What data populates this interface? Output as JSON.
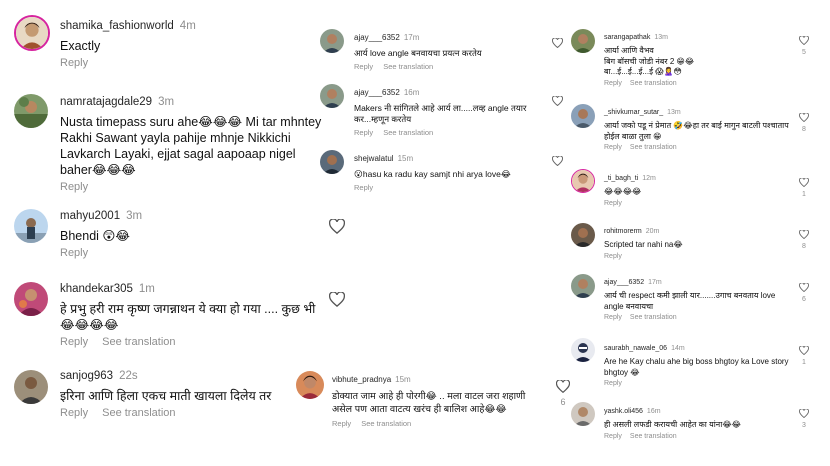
{
  "left": {
    "comments": [
      {
        "user": "shamika_fashionworld",
        "time": "4m",
        "text": "Exactly",
        "reply": "Reply"
      },
      {
        "user": "namratajagdale29",
        "time": "3m",
        "text": "Nusta timepass suru ahe😂😂😂 Mi tar mhntey Rakhi Sawant yayla pahije mhnje Nikkichi Lavkarch Layaki, ejjat sagal aapoaap nigel baher😂😂😂",
        "reply": "Reply"
      },
      {
        "user": "mahyu2001",
        "time": "3m",
        "text": "Bhendi 😲😂",
        "reply": "Reply"
      },
      {
        "user": "khandekar305",
        "time": "1m",
        "text": "हे प्रभु हरी राम कृष्ण जगन्नाथन ये क्या हो गया .... कुछ भी 😂😂😂😂",
        "reply": "Reply",
        "translate": "See translation"
      },
      {
        "user": "sanjog963",
        "time": "22s",
        "text": "इरिना आणि हिला एकच माती खायला दिलेय तर",
        "reply": "Reply",
        "translate": "See translation"
      }
    ]
  },
  "mid": {
    "comments": [
      {
        "user": "ajay___6352",
        "time": "17m",
        "text": "आर्य love angle बनवायचा प्रयत्न करतेय",
        "reply": "Reply",
        "translate": "See translation"
      },
      {
        "user": "ajay___6352",
        "time": "16m",
        "text": "Makers नी सांगितले आहे आर्य ला.....लव्ह angle तयार कर...म्हणून करतेय",
        "reply": "Reply",
        "translate": "See translation"
      },
      {
        "user": "shejwalatul",
        "time": "15m",
        "text": "😮hasu ka radu kay samjt nhi arya love😂",
        "reply": "Reply"
      },
      {
        "user": "vibhute_pradnya",
        "time": "15m",
        "text": "डोक्यात जाम आहे ही पोरगी😂 .. मला वाटल जरा शहाणी असेल पण आता वाटत्य खरंच ही बालिश आहे😂😂",
        "reply": "Reply",
        "translate": "See translation",
        "likes": "6"
      }
    ]
  },
  "right": {
    "comments": [
      {
        "user": "sarangapathak",
        "time": "13m",
        "text": "आर्या आणि वैभव\nबिग बॉसची जोडी नंबर 2 😁😂\nबा...ई...ई...ई...ई 😱🙎‍♀️😳",
        "reply": "Reply",
        "translate": "See translation",
        "likes": "5"
      },
      {
        "user": "_shivkumar_sutar_",
        "time": "13m",
        "text": "आर्या जको पडू नं प्रेमात 🤣😂हा तर बाई मागुन बाटली पश्चाताप होईल बाळा तुला 😁",
        "reply": "Reply",
        "translate": "See translation",
        "likes": "8"
      },
      {
        "user": "_ti_bagh_ti",
        "time": "12m",
        "text": "😂😂😂😂",
        "reply": "Reply",
        "likes": "1"
      },
      {
        "user": "rohitmorerm",
        "time": "20m",
        "text": "Scripted tar nahi na😂",
        "reply": "Reply",
        "likes": "8"
      },
      {
        "user": "ajay___6352",
        "time": "17m",
        "text": "आर्य ची respect कमी झाली यार.......उगाच बनवताय love angle बनवायचा",
        "reply": "Reply",
        "translate": "See translation",
        "likes": "6"
      },
      {
        "user": "saurabh_nawale_06",
        "time": "14m",
        "text": "Are he Kay chalu ahe big boss bhgtoy ka Love story bhgtoy 😂",
        "reply": "Reply",
        "likes": "1"
      },
      {
        "user": "yashk.oli456",
        "time": "16m",
        "text": "ही असली लफडी करायची आहेत का यांना😂😂",
        "reply": "Reply",
        "translate": "See translation",
        "likes": "3"
      }
    ]
  }
}
